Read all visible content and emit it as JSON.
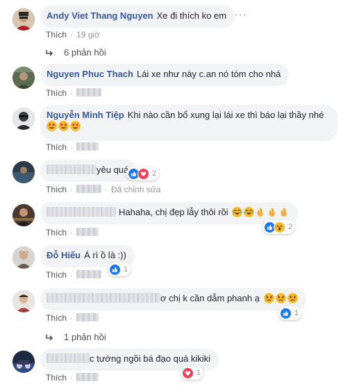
{
  "meta": {
    "like_label": "Thích"
  },
  "comments": [
    {
      "author": "Andy Viet Thang Nguyen",
      "text": "Xe đi thích ko em",
      "time": "19 giờ",
      "reply_link": "6 phản hồi"
    },
    {
      "author": "Nguyen Phuc Thach",
      "text": "Lái xe như này c.an nó tóm cho nhá"
    },
    {
      "author": "Nguyễn Minh Tiệp",
      "text": "Khi nào cần bổ xung lại lái xe thì báo lại thầy nhé"
    },
    {
      "text": "yêu quá",
      "reaction_count": "2"
    },
    {
      "text": "Hahaha, chị đẹp lẫy thôi rồi",
      "reaction_count": "2",
      "edited": "Đã chỉnh sửa"
    },
    {
      "author": "Đỗ Hiếu",
      "text": "Á rì ồ là :))",
      "reaction_count": "1"
    },
    {
      "text": "ơ chị k cần dẫm phanh ạ",
      "reaction_count": "1",
      "reply_link": "1 phản hồi"
    },
    {
      "text": "c tướng ngồi bá đạo quá kikiki",
      "reaction_count": "1"
    }
  ],
  "colors": {
    "author": "#385898",
    "bubble": "#f2f3f5",
    "meta": "#90949c",
    "like_blue": "#1877f2",
    "love_red": "#f33e58",
    "haha_yellow": "#f7b928"
  }
}
